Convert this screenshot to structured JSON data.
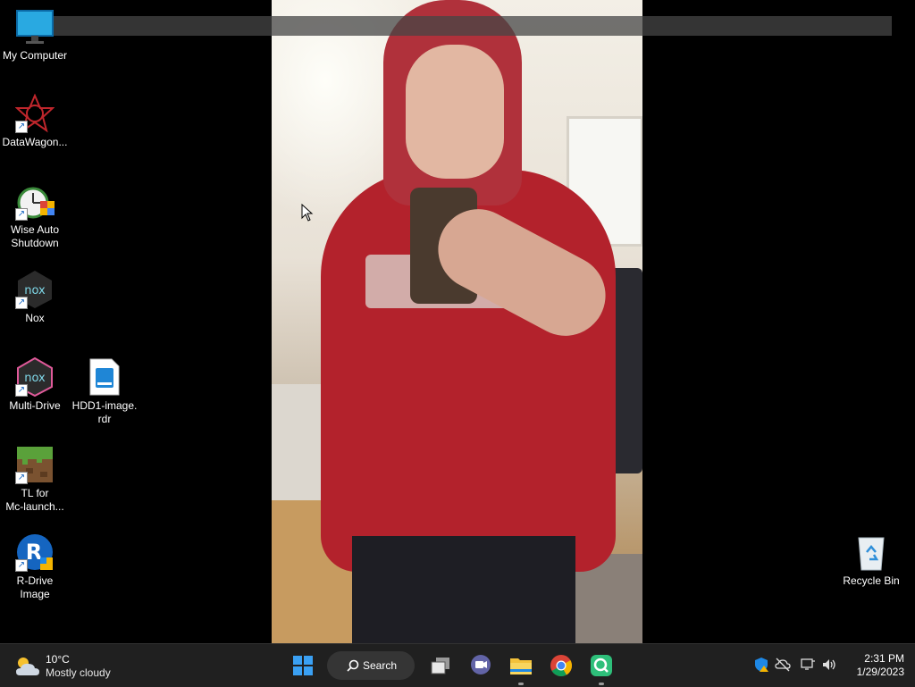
{
  "desktop": {
    "icons": [
      {
        "label": "My Computer",
        "icon": "my-computer-icon"
      },
      {
        "label": "DataWagon...",
        "icon": "datawagon-icon",
        "shortcut": true
      },
      {
        "label": "Wise Auto\nShutdown",
        "icon": "wise-auto-shutdown-icon",
        "shortcut": true
      },
      {
        "label": "Nox",
        "icon": "nox-icon",
        "shortcut": true
      },
      {
        "label": "Multi-Drive",
        "icon": "nox-multidrive-icon",
        "shortcut": true
      },
      {
        "label": "HDD1-image.\nrdr",
        "icon": "hdd-image-file-icon"
      },
      {
        "label": "TL for\nMc-launch...",
        "icon": "minecraft-launcher-icon",
        "shortcut": true
      },
      {
        "label": "R-Drive\nImage",
        "icon": "r-drive-image-icon",
        "shortcut": true
      },
      {
        "label": "Recycle Bin",
        "icon": "recycle-bin-icon"
      }
    ]
  },
  "taskbar": {
    "weather": {
      "temperature": "10°C",
      "condition": "Mostly cloudy",
      "icon": "partly-cloudy-icon"
    },
    "start_icon": "windows-start-icon",
    "search_label": "Search",
    "pinned": [
      {
        "name": "Task View",
        "icon": "task-view-icon"
      },
      {
        "name": "Chat",
        "icon": "teams-chat-icon"
      },
      {
        "name": "File Explorer",
        "icon": "file-explorer-icon",
        "running": true
      },
      {
        "name": "Google Chrome",
        "icon": "chrome-icon"
      },
      {
        "name": "Screen capture",
        "icon": "magnifier-app-icon",
        "running": true
      }
    ],
    "tray_icons": [
      "security-shield-icon",
      "onedrive-icon",
      "network-icon",
      "volume-icon"
    ],
    "clock": {
      "time": "2:31 PM",
      "date": "1/29/2023"
    }
  },
  "colors": {
    "taskbar": "#202020",
    "accent": "#0078d4"
  }
}
